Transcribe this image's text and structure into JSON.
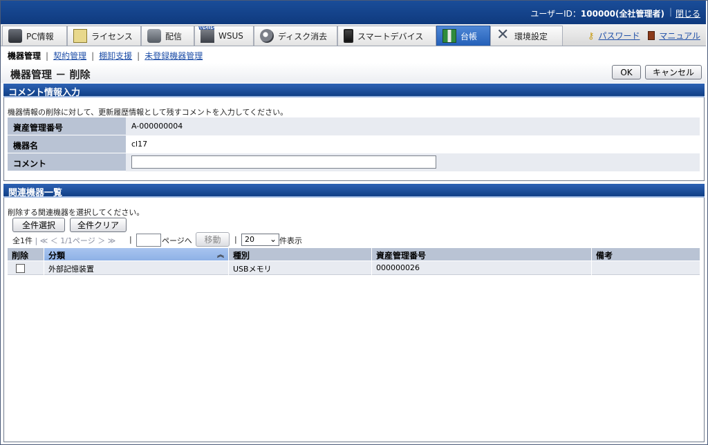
{
  "header": {
    "user_label": "ユーザーID：",
    "user_value": "100000(全社管理者)",
    "sep": "|",
    "close": "閉じる"
  },
  "tabs": [
    {
      "label": "PC情報",
      "icon": "pc-icon"
    },
    {
      "label": "ライセンス",
      "icon": "license-icon"
    },
    {
      "label": "配信",
      "icon": "distribution-icon"
    },
    {
      "label": "WSUS",
      "icon": "wsus-icon"
    },
    {
      "label": "ディスク消去",
      "icon": "disk-erase-icon"
    },
    {
      "label": "スマートデバイス",
      "icon": "smart-device-icon"
    },
    {
      "label": "台帳",
      "icon": "ledger-icon",
      "active": true
    },
    {
      "label": "環境設定",
      "icon": "tools-icon"
    }
  ],
  "toplinks": {
    "password": "パスワード",
    "manual": "マニュアル"
  },
  "subnav": {
    "current": "機器管理",
    "links": [
      "契約管理",
      "棚卸支援",
      "未登録機器管理"
    ],
    "sep": "|"
  },
  "page": {
    "title": "機器管理 － 削除",
    "ok": "OK",
    "cancel": "キャンセル"
  },
  "comment_section": {
    "title": "コメント情報入力",
    "description": "機器情報の削除に対して、更新履歴情報として残すコメントを入力してください。",
    "rows": [
      {
        "label": "資産管理番号",
        "value": "A-000000004"
      },
      {
        "label": "機器名",
        "value": "cl17"
      },
      {
        "label": "コメント",
        "value": ""
      }
    ]
  },
  "related_section": {
    "title": "関連機器一覧",
    "description": "削除する関連機器を選択してください。",
    "select_all": "全件選択",
    "clear_all": "全件クリア",
    "pager": {
      "total": "全1件",
      "sep": "|",
      "nav": "≪ ＜ 1/1ページ ＞ ≫",
      "page_input": "",
      "goto_label": "ページへ",
      "move": "移動",
      "per_page": "20",
      "per_page_label": "件表示"
    },
    "columns": [
      "削除",
      "分類",
      "種別",
      "資産管理番号",
      "備考"
    ],
    "rows": [
      {
        "delete": false,
        "category": "外部記憶装置",
        "type": "USBメモリ",
        "asset_no": "000000026",
        "note": ""
      }
    ]
  },
  "colors": {
    "header_blue": "#1a4d99",
    "active_tab": "#2460b8",
    "label_bg": "#b9c3d4",
    "link": "#1f4fa8"
  }
}
